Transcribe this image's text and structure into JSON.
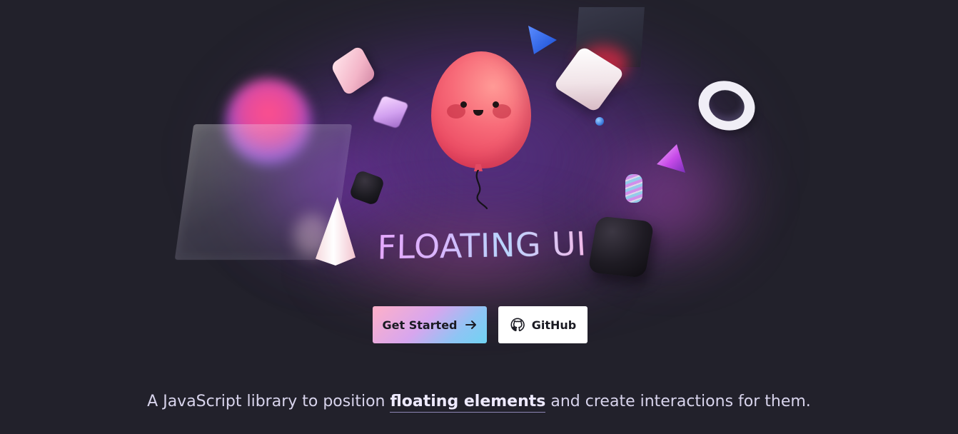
{
  "hero": {
    "logo_text": "FLOATING UI",
    "decor_icons": [
      "balloon-icon",
      "torus-icon",
      "cube-icon",
      "cone-icon",
      "triangle-icon",
      "spring-icon",
      "glass-panel-icon"
    ]
  },
  "actions": {
    "primary_label": "Get Started",
    "primary_icon": "arrow-right-icon",
    "secondary_label": "GitHub",
    "secondary_icon": "github-icon"
  },
  "tagline": {
    "before": "A JavaScript library to position ",
    "link": "floating elements",
    "after": " and create interactions for them."
  },
  "colors": {
    "background": "#22212b",
    "balloon": "#f25f72",
    "primary_gradient_start": "#ffb0c8",
    "primary_gradient_end": "#6fd3f2",
    "secondary_button": "#ffffff",
    "tagline_text": "#d8d4ec"
  }
}
